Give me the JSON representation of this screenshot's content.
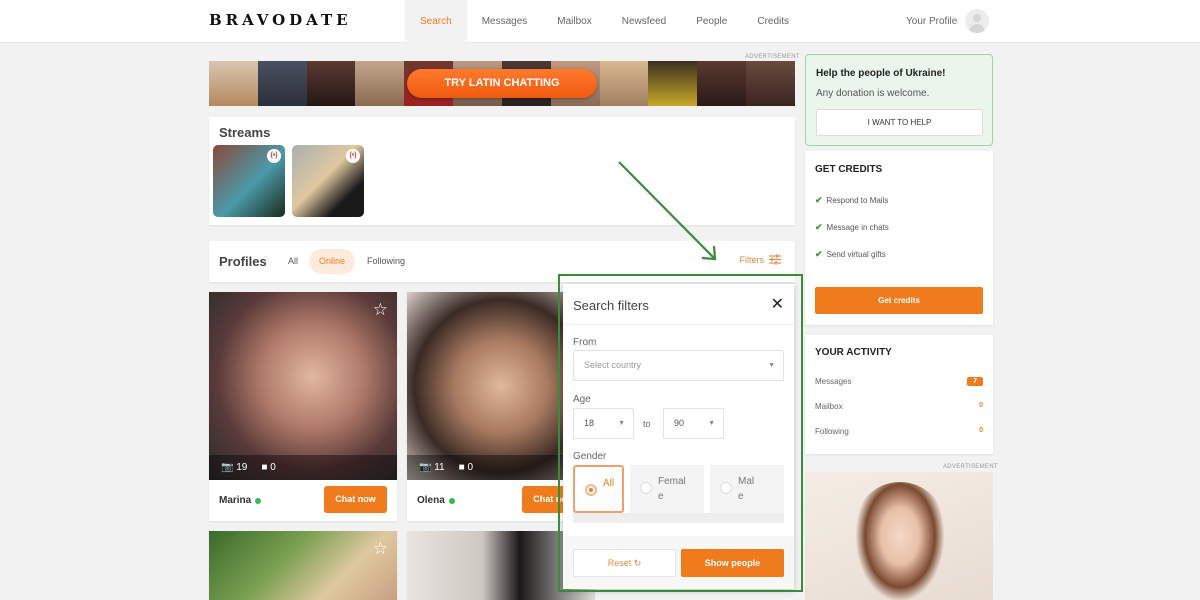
{
  "header": {
    "logo": "BRAVODATE",
    "nav": [
      {
        "label": "Search",
        "active": true
      },
      {
        "label": "Messages"
      },
      {
        "label": "Mailbox"
      },
      {
        "label": "Newsfeed"
      },
      {
        "label": "People"
      },
      {
        "label": "Credits"
      }
    ],
    "profile_label": "Your Profile",
    "avatar_icon": "user-avatar-icon"
  },
  "banner": {
    "ad_label": "ADVERTISEMENT",
    "button_label": "TRY LATIN CHATTING"
  },
  "streams": {
    "title": "Streams",
    "items": [
      {
        "live_icon": "live-broadcast-icon",
        "glyph": "(•)"
      },
      {
        "live_icon": "live-broadcast-icon",
        "glyph": "(•)"
      }
    ]
  },
  "profiles": {
    "title": "Profiles",
    "tabs": [
      {
        "label": "All"
      },
      {
        "label": "Online",
        "active": true
      },
      {
        "label": "Following"
      }
    ],
    "filters_label": "Filters",
    "filters_icon": "sliders-icon",
    "cards": [
      {
        "name": "Marina",
        "photos": "19",
        "videos": "0",
        "chat_label": "Chat now",
        "online": true
      },
      {
        "name": "Olena",
        "photos": "11",
        "videos": "0",
        "chat_label": "Chat now",
        "online": true
      }
    ]
  },
  "filter_modal": {
    "title": "Search filters",
    "close_glyph": "✕",
    "from_label": "From",
    "country_placeholder": "Select country",
    "age_label": "Age",
    "age_from": "18",
    "age_to_label": "to",
    "age_to": "90",
    "gender_label": "Gender",
    "gender_options": [
      {
        "label": "All",
        "selected": true
      },
      {
        "label": "Female"
      },
      {
        "label": "Male"
      }
    ],
    "reset_label": "Reset",
    "show_label": "Show people"
  },
  "sidebar": {
    "ukraine": {
      "title": "Help the people of Ukraine!",
      "subtitle": "Any donation is welcome.",
      "button_label": "I WANT TO HELP"
    },
    "get_credits": {
      "title": "GET CREDITS",
      "items": [
        "Respond to Mails",
        "Message in chats",
        "Send virtual gifts"
      ],
      "button_label": "Get credits"
    },
    "activity": {
      "title": "YOUR ACTIVITY",
      "rows": [
        {
          "label": "Messages",
          "value": "7",
          "badge": true
        },
        {
          "label": "Mailbox",
          "value": "0"
        },
        {
          "label": "Following",
          "value": "0"
        }
      ]
    },
    "ad_label": "ADVERTISEMENT"
  },
  "colors": {
    "accent": "#f07b1d",
    "highlight": "#3a8c3a",
    "online": "#3cb55a"
  }
}
